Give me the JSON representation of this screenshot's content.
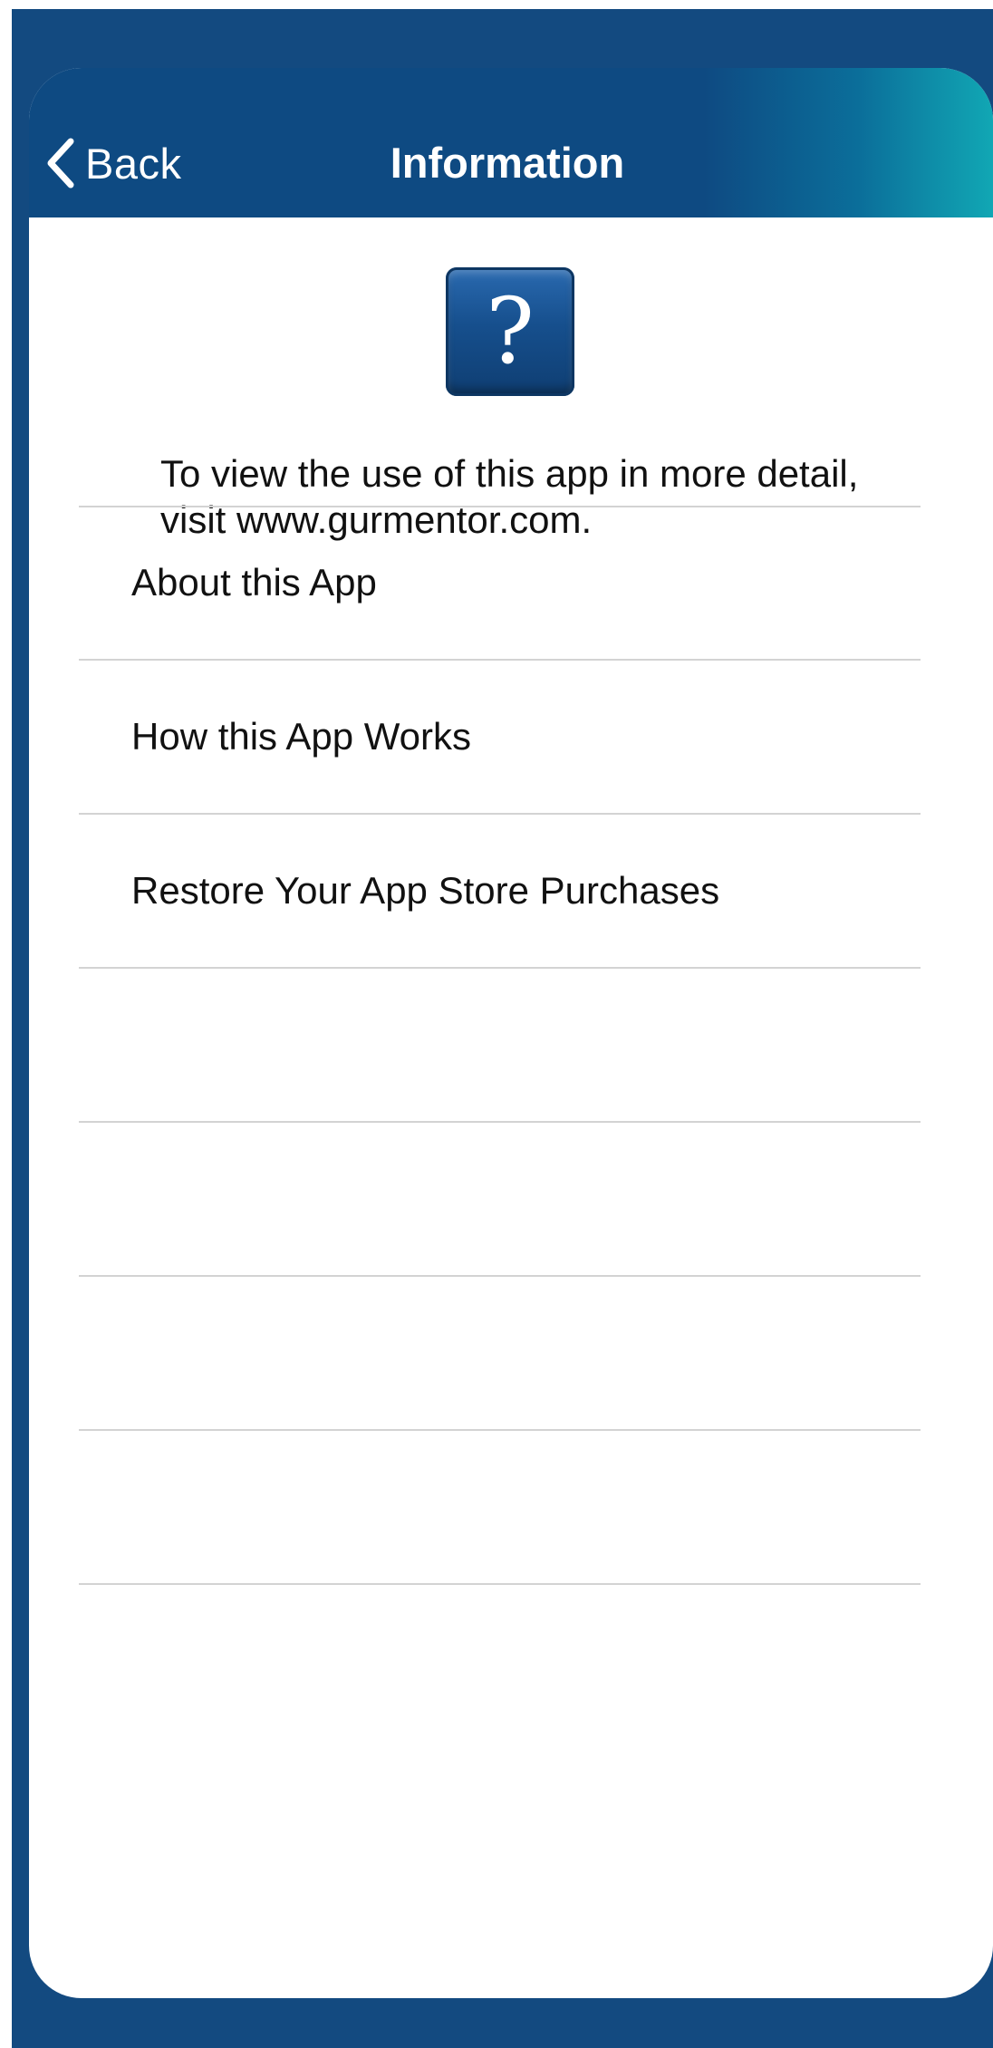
{
  "nav": {
    "back_label": "Back",
    "title": "Information",
    "back_icon": "chevron-left-icon",
    "colors": {
      "bar": "#0e4a82",
      "bar_gradient_end": "#11a7b4",
      "frame": "#134a80"
    }
  },
  "help_tile": {
    "icon": "question-mark-icon",
    "glyph": "?"
  },
  "intro": {
    "text": "To view the use of this app in more detail, visit www.gurmentor.com."
  },
  "menu": {
    "items": [
      {
        "label": "About this App"
      },
      {
        "label": "How this App Works"
      },
      {
        "label": "Restore Your App Store Purchases"
      },
      {
        "label": ""
      },
      {
        "label": ""
      },
      {
        "label": ""
      },
      {
        "label": ""
      }
    ]
  }
}
